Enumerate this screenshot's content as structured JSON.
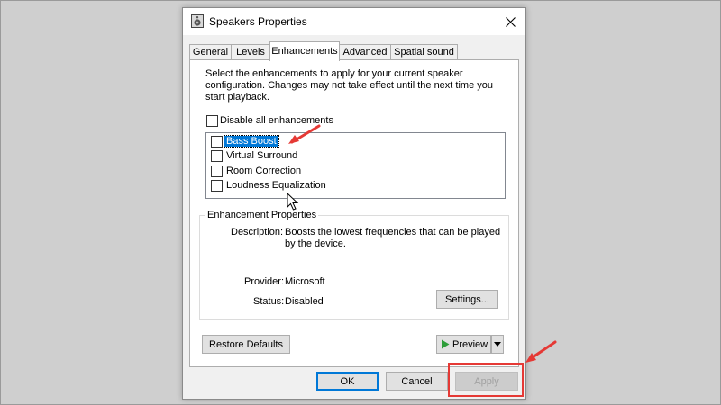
{
  "window": {
    "title": "Speakers Properties"
  },
  "tabs": [
    {
      "label": "General"
    },
    {
      "label": "Levels"
    },
    {
      "label": "Enhancements"
    },
    {
      "label": "Advanced"
    },
    {
      "label": "Spatial sound"
    }
  ],
  "active_tab": "Enhancements",
  "description": "Select the enhancements to apply for your current speaker configuration. Changes may not take effect until the next time you start playback.",
  "disable_all": {
    "label": "Disable all enhancements",
    "checked": false
  },
  "enhancements": [
    {
      "label": "Bass Boost",
      "checked": false,
      "selected": true
    },
    {
      "label": "Virtual Surround",
      "checked": false
    },
    {
      "label": "Room Correction",
      "checked": false
    },
    {
      "label": "Loudness Equalization",
      "checked": false
    }
  ],
  "properties": {
    "title": "Enhancement Properties",
    "description_label": "Description:",
    "description_value": "Boosts the lowest frequencies that can be played by the device.",
    "provider_label": "Provider:",
    "provider_value": "Microsoft",
    "status_label": "Status:",
    "status_value": "Disabled",
    "settings_button": "Settings..."
  },
  "buttons": {
    "restore_defaults": "Restore Defaults",
    "preview": "Preview",
    "ok": "OK",
    "cancel": "Cancel",
    "apply": "Apply"
  },
  "colors": {
    "selection": "#0078d7",
    "annotation": "#e53935",
    "play_icon": "#2e9e3a"
  },
  "icons": [
    "speaker-icon",
    "close-icon",
    "play-icon",
    "dropdown-arrow-icon",
    "mouse-cursor-icon",
    "annotation-arrow-icon"
  ]
}
